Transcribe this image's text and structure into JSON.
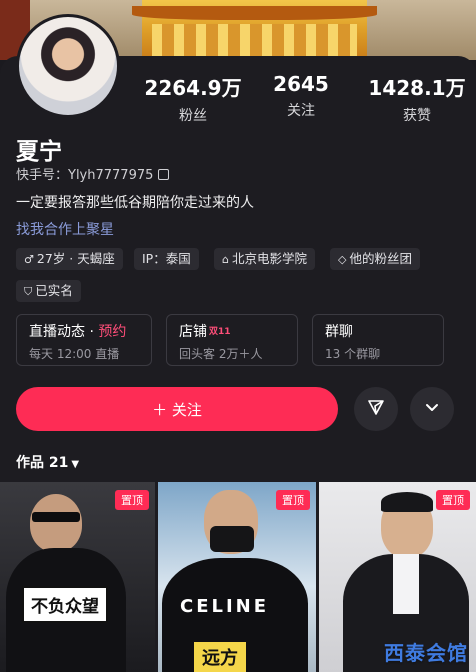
{
  "profile": {
    "name": "夏宁",
    "kuaishou_id": "快手号：Ylyh7777975",
    "bio": "一定要报答那些低谷期陪你走过来的人",
    "collab_link": "找我合作上聚星"
  },
  "stats": [
    {
      "value": "2264.9万",
      "label": "粉丝"
    },
    {
      "value": "2645",
      "label": "关注"
    },
    {
      "value": "1428.1万",
      "label": "获赞"
    }
  ],
  "tags": [
    {
      "icon": "male-icon",
      "glyph": "♂",
      "text": "27岁 · 天蝎座"
    },
    {
      "icon": "",
      "glyph": "",
      "text": "IP：泰国"
    },
    {
      "icon": "graduation-cap-icon",
      "glyph": "⌂",
      "text": "北京电影学院"
    },
    {
      "icon": "fan-club-icon",
      "glyph": "◇",
      "text": "他的粉丝团"
    },
    {
      "icon": "verified-shield-icon",
      "glyph": "⛉",
      "text": "已实名"
    }
  ],
  "boxes": {
    "live": {
      "title": "直播动态 · ",
      "highlight": "预约",
      "sub": "每天 12:00 直播"
    },
    "shop": {
      "title": "店铺",
      "badge": "双11",
      "sub": "回头客 2万＋人"
    },
    "group": {
      "title": "群聊",
      "sub": "13 个群聊"
    }
  },
  "actions": {
    "follow_label": "＋ 关注"
  },
  "works": {
    "label": "作品 21",
    "pin_label": "置顶"
  },
  "thumbnails": [
    {
      "caption": "不负众望"
    },
    {
      "caption": "远方"
    },
    {
      "caption": ""
    }
  ],
  "watermark": "西泰会馆",
  "colors": {
    "accent": "#fe2c55",
    "background": "#1d1c21",
    "link": "#8a9bd9"
  }
}
